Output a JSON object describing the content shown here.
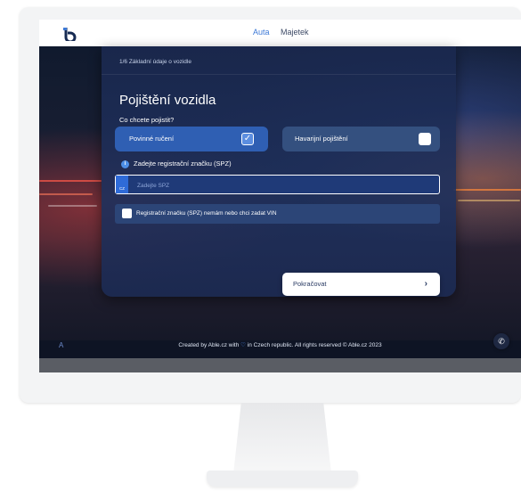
{
  "nav": {
    "items": [
      "Auta",
      "Majetek"
    ]
  },
  "card": {
    "step": "1/6 Základní údaje o vozidle",
    "title": "Pojištění vozidla",
    "question": "Co chcete pojistit?",
    "option_1": "Povinné ručení",
    "option_1_checked": true,
    "option_2": "Havarijní pojištění",
    "option_2_checked": false,
    "spz_label": "Zadejte registrační značku (SPZ)",
    "spz_country": "CZ",
    "spz_placeholder": "Zadejte SPZ",
    "vin_checkbox_label": "Registrační značku (SPZ) nemám nebo chci zadat VIN",
    "continue_label": "Pokračovat"
  },
  "footer": {
    "text_before": "Created by Able.cz with",
    "text_after": "in Czech republic. All rights reserved © Able.cz 2023",
    "left_icon": "accessibility-icon",
    "phone_icon": "phone-icon"
  },
  "colors": {
    "accent": "#2f5fb3",
    "brand_dark": "#162a52",
    "nav_active": "#3d79d6"
  }
}
